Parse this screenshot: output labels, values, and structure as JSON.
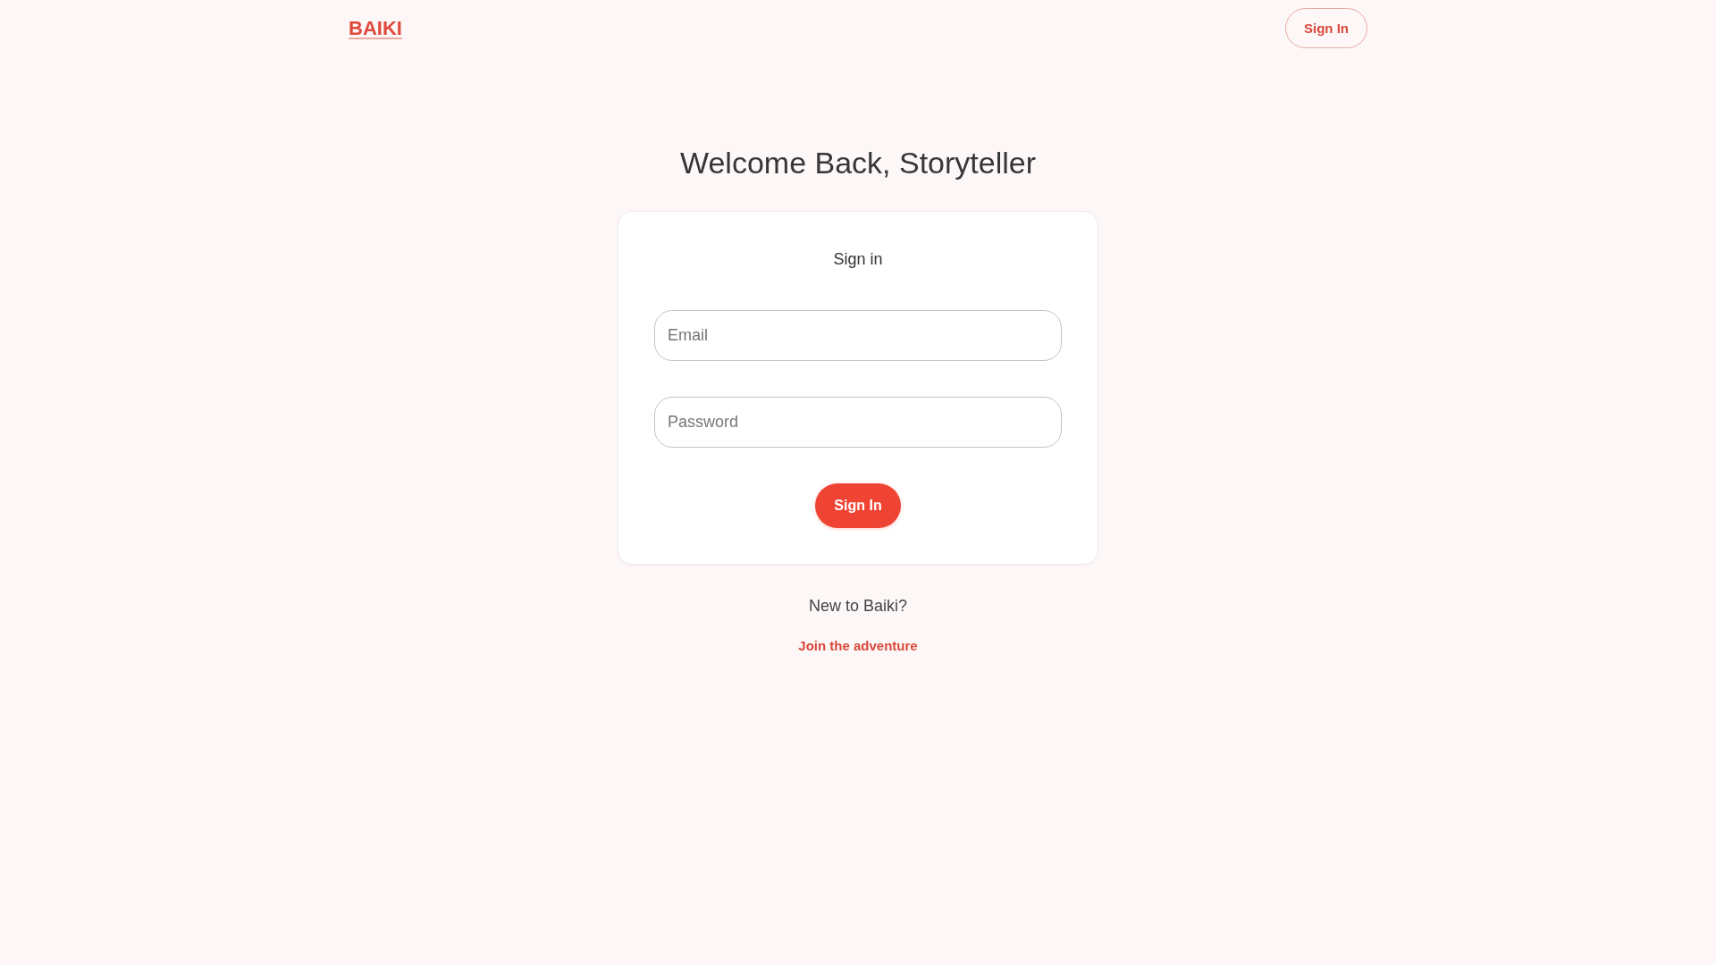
{
  "header": {
    "logo": "BAIKI",
    "sign_in_button": "Sign In"
  },
  "main": {
    "title": "Welcome Back, Storyteller",
    "card": {
      "heading": "Sign in",
      "fields": [
        {
          "placeholder": "Email"
        },
        {
          "placeholder": "Password"
        }
      ],
      "submit_button": "Sign In"
    },
    "signup_prompt": "New to Baiki?",
    "signup_link": "Join the adventure"
  }
}
